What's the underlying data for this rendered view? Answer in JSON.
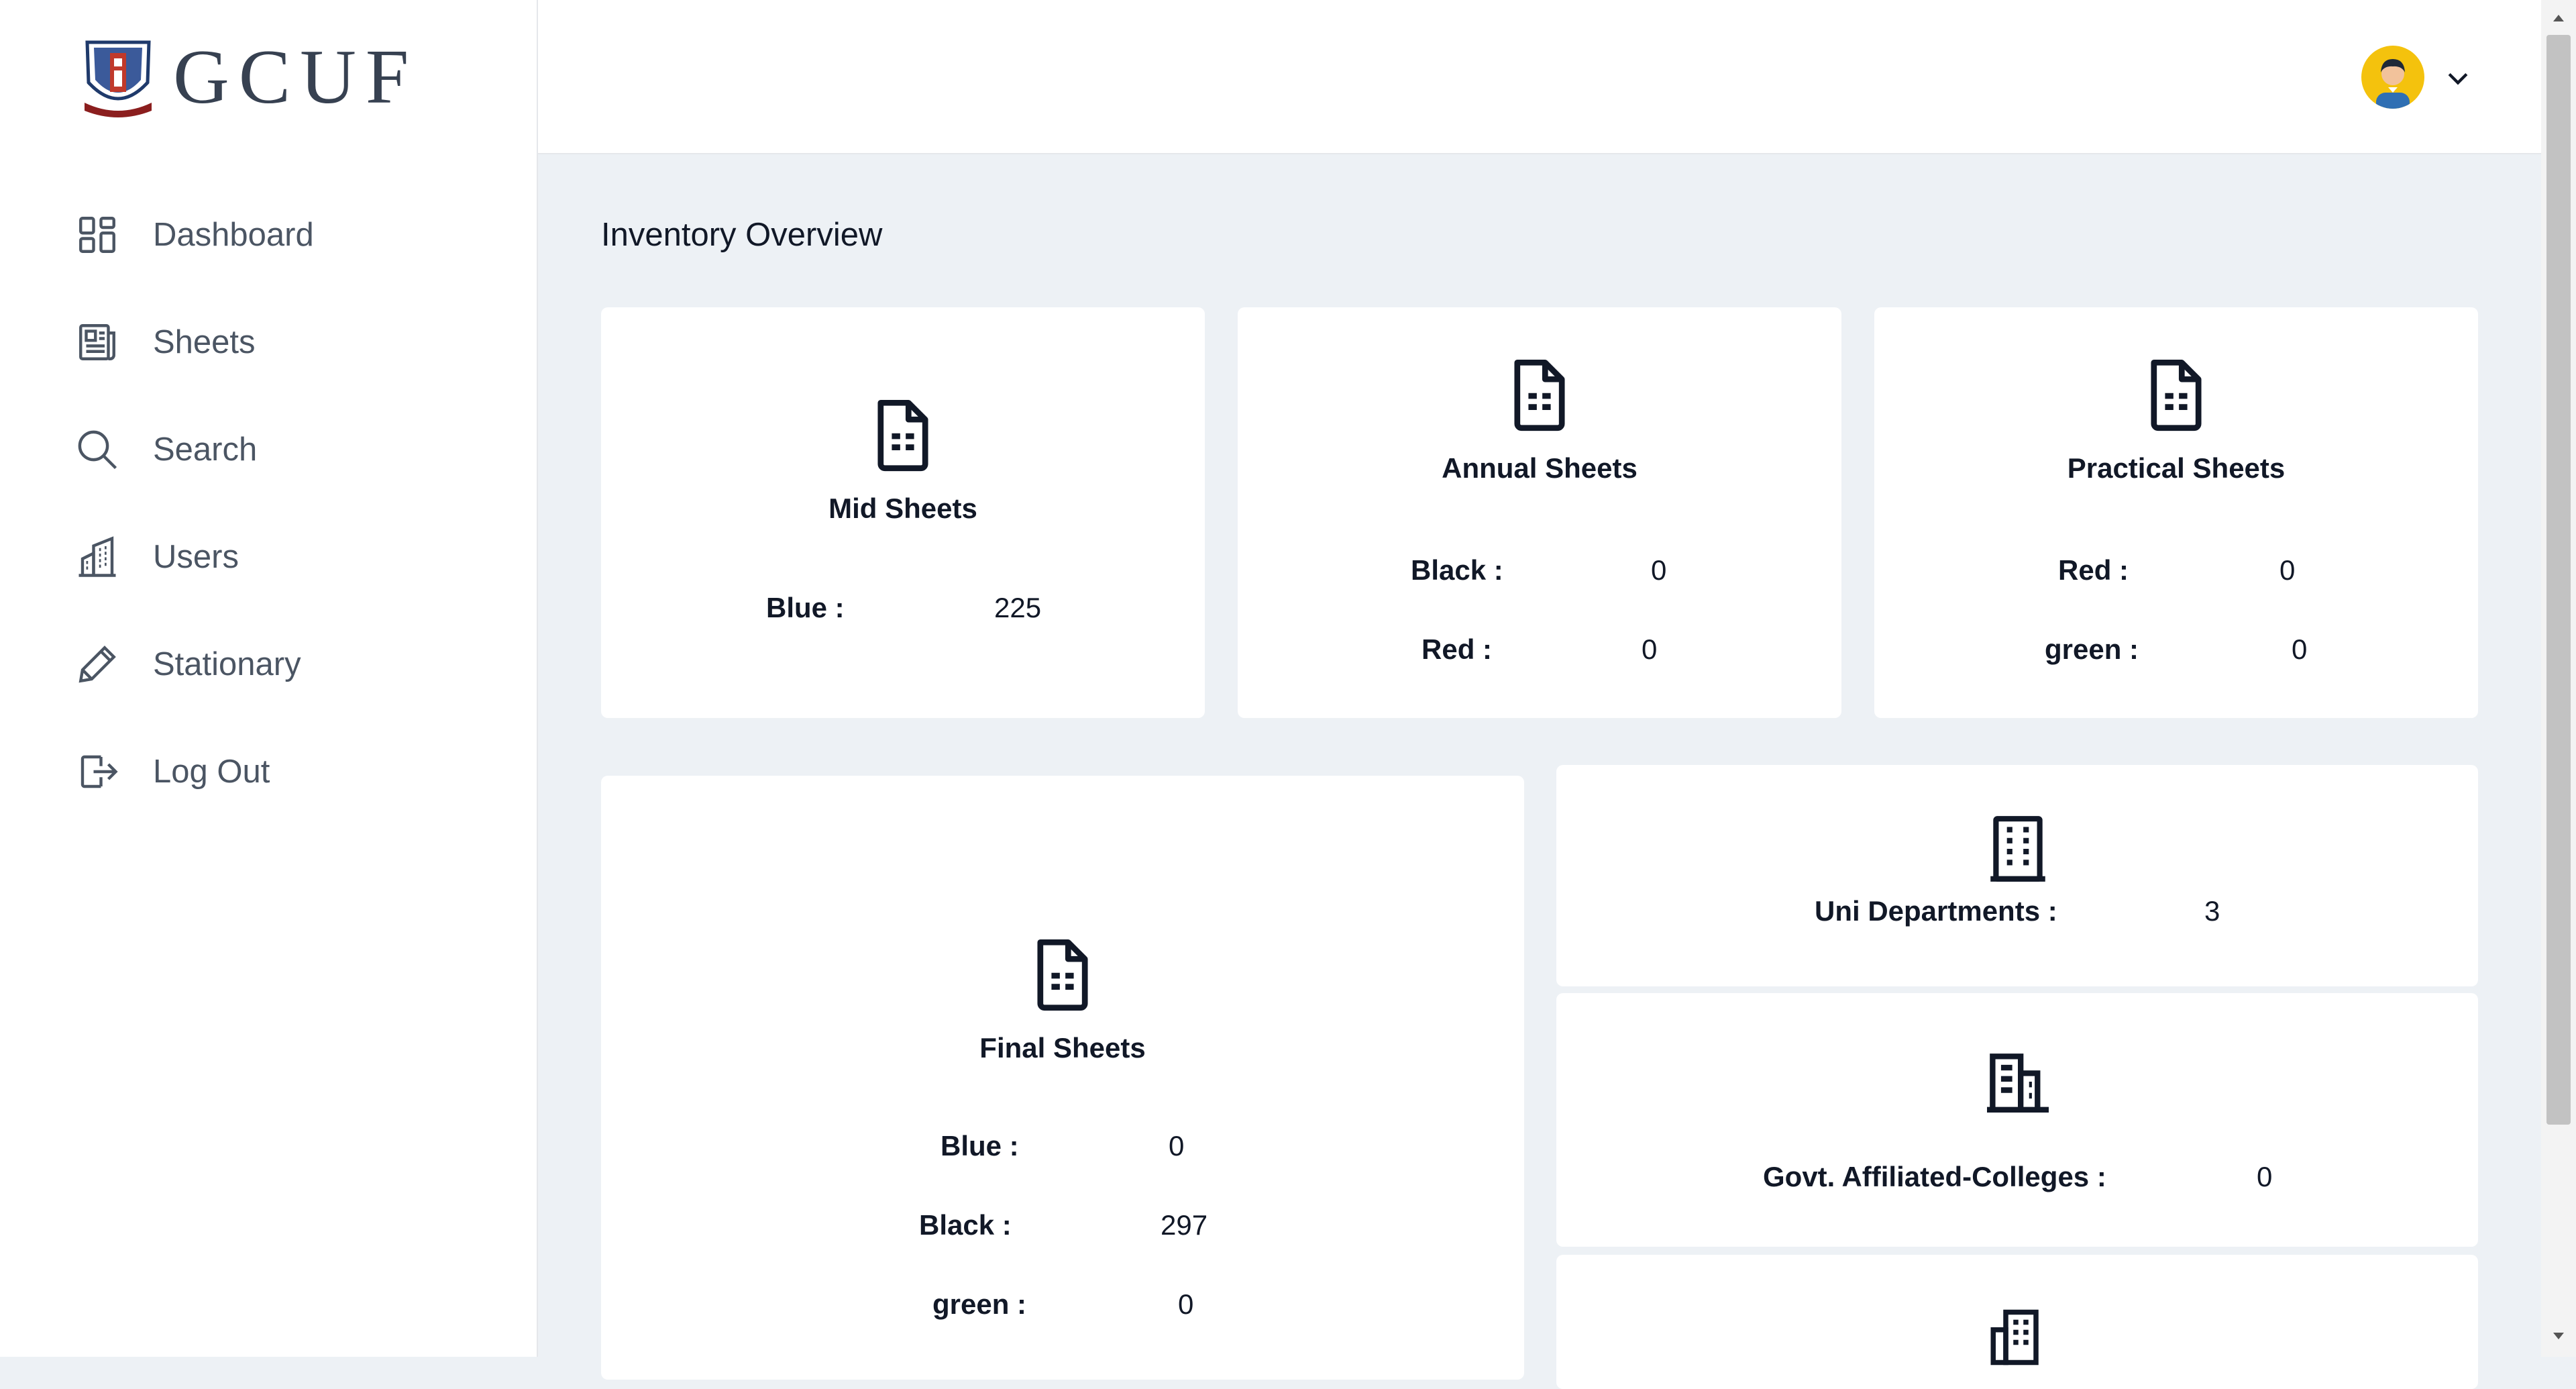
{
  "brand": {
    "logo_text": "GCUF"
  },
  "sidebar": {
    "items": [
      {
        "label": "Dashboard",
        "icon": "dashboard-icon"
      },
      {
        "label": "Sheets",
        "icon": "sheets-icon"
      },
      {
        "label": "Search",
        "icon": "search-icon"
      },
      {
        "label": "Users",
        "icon": "users-icon"
      },
      {
        "label": "Stationary",
        "icon": "pencil-icon"
      },
      {
        "label": "Log Out",
        "icon": "logout-icon"
      }
    ]
  },
  "header": {
    "avatar_color": "#f4c20d"
  },
  "main": {
    "title": "Inventory Overview",
    "cards": {
      "mid": {
        "title": "Mid Sheets",
        "rows": [
          {
            "label": "Blue :",
            "value": "225"
          }
        ]
      },
      "annual": {
        "title": "Annual Sheets",
        "rows": [
          {
            "label": "Black :",
            "value": "0"
          },
          {
            "label": "Red :",
            "value": "0"
          }
        ]
      },
      "practical": {
        "title": "Practical Sheets",
        "rows": [
          {
            "label": "Red :",
            "value": "0"
          },
          {
            "label": "green :",
            "value": "0"
          }
        ]
      },
      "final": {
        "title": "Final Sheets",
        "rows": [
          {
            "label": "Blue :",
            "value": "0"
          },
          {
            "label": "Black :",
            "value": "297"
          },
          {
            "label": "green :",
            "value": "0"
          }
        ]
      },
      "uni_departments": {
        "label": "Uni Departments :",
        "value": "3",
        "icon": "building-icon"
      },
      "govt_colleges": {
        "label": "Govt. Affiliated-Colleges :",
        "value": "0",
        "icon": "office-building-icon"
      },
      "third_building": {
        "icon": "buildings-icon"
      }
    }
  }
}
